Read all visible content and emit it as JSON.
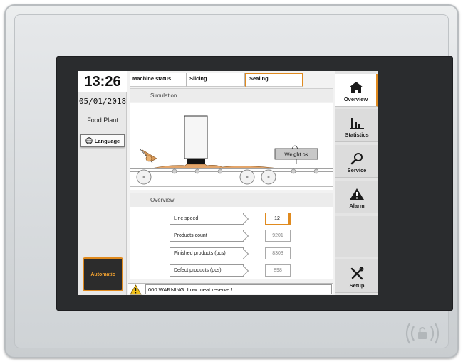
{
  "header": {
    "time": "13:26",
    "date": "05/01/2018",
    "plant": "Food Plant",
    "language_label": "Language"
  },
  "tabs": [
    {
      "label": "Machine status"
    },
    {
      "label": "Slicing"
    },
    {
      "label": "Sealing",
      "active": true
    }
  ],
  "simulation": {
    "title": "Simulation",
    "weight_label": "Weight ok"
  },
  "overview": {
    "title": "Overview",
    "rows": [
      {
        "label": "Line speed",
        "value": "12",
        "active": true
      },
      {
        "label": "Products count",
        "value": "9201"
      },
      {
        "label": "Finished products (pcs)",
        "value": "8303"
      },
      {
        "label": "Defect products (pcs)",
        "value": "898"
      }
    ]
  },
  "mode": {
    "label": "Automatic"
  },
  "status": {
    "message": "000  WARNING:  Low meat reserve !"
  },
  "nav": [
    {
      "label": "Overview",
      "icon": "home-icon",
      "active": true
    },
    {
      "label": "Statistics",
      "icon": "bar-chart-icon"
    },
    {
      "label": "Service",
      "icon": "magnifier-icon"
    },
    {
      "label": "Alarm",
      "icon": "warning-icon"
    },
    {
      "label": "Setup",
      "icon": "tools-icon"
    }
  ],
  "colors": {
    "accent": "#e08a1e",
    "bezel": "#2a2c2e",
    "panel": "#e8e8e8"
  }
}
